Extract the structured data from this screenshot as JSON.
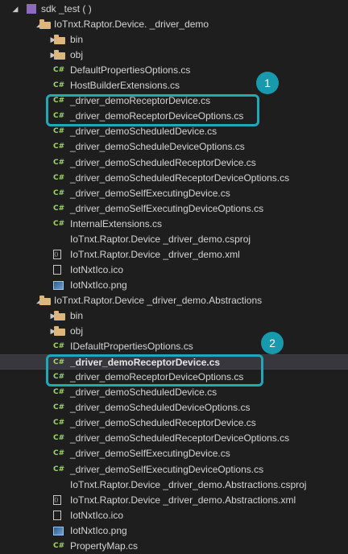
{
  "rows": [
    {
      "label": "sdk     _test (                                        )",
      "kind": "solution",
      "expanded": true
    },
    {
      "label": "IoTnxt.Raptor.Device.      _driver_demo",
      "kind": "folder",
      "expanded": true
    },
    {
      "label": "bin",
      "kind": "folder",
      "expanded": false
    },
    {
      "label": "obj",
      "kind": "folder",
      "expanded": false
    },
    {
      "label": "DefaultPropertiesOptions.cs",
      "kind": "cs"
    },
    {
      "label": "HostBuilderExtensions.cs",
      "kind": "cs"
    },
    {
      "label": "_driver_demoReceptorDevice.cs",
      "kind": "cs"
    },
    {
      "label": "_driver_demoReceptorDeviceOptions.cs",
      "kind": "cs"
    },
    {
      "label": "_driver_demoScheduledDevice.cs",
      "kind": "cs"
    },
    {
      "label": "_driver_demoScheduleDeviceOptions.cs",
      "kind": "cs"
    },
    {
      "label": "_driver_demoScheduledReceptorDevice.cs",
      "kind": "cs"
    },
    {
      "label": "_driver_demoScheduledReceptorDeviceOptions.cs",
      "kind": "cs"
    },
    {
      "label": "_driver_demoSelfExecutingDevice.cs",
      "kind": "cs"
    },
    {
      "label": "_driver_demoSelfExecutingDeviceOptions.cs",
      "kind": "cs"
    },
    {
      "label": "InternalExtensions.cs",
      "kind": "cs"
    },
    {
      "label": "IoTnxt.Raptor.Device       _driver_demo.csproj",
      "kind": "csproj"
    },
    {
      "label": "IoTnxt.Raptor.Device       _driver_demo.xml",
      "kind": "xml"
    },
    {
      "label": "IotNxtIco.ico",
      "kind": "ico"
    },
    {
      "label": "IotNxtIco.png",
      "kind": "png"
    },
    {
      "label": "IoTnxt.Raptor.Device       _driver_demo.Abstractions",
      "kind": "folder",
      "expanded": true
    },
    {
      "label": "bin",
      "kind": "folder",
      "expanded": false
    },
    {
      "label": "obj",
      "kind": "folder",
      "expanded": false
    },
    {
      "label": "IDefaultPropertiesOptions.cs",
      "kind": "cs"
    },
    {
      "label": "_driver_demoReceptorDevice.cs",
      "kind": "cs",
      "selected": true
    },
    {
      "label": "_driver_demoReceptorDeviceOptions.cs",
      "kind": "cs"
    },
    {
      "label": "_driver_demoScheduledDevice.cs",
      "kind": "cs"
    },
    {
      "label": "_driver_demoScheduledDeviceOptions.cs",
      "kind": "cs"
    },
    {
      "label": "_driver_demoScheduledReceptorDevice.cs",
      "kind": "cs"
    },
    {
      "label": "_driver_demoScheduledReceptorDeviceOptions.cs",
      "kind": "cs"
    },
    {
      "label": "_driver_demoSelfExecutingDevice.cs",
      "kind": "cs"
    },
    {
      "label": "_driver_demoSelfExecutingDeviceOptions.cs",
      "kind": "cs"
    },
    {
      "label": "IoTnxt.Raptor.Device       _driver_demo.Abstractions.csproj",
      "kind": "csproj"
    },
    {
      "label": "IoTnxt.Raptor.Device       _driver_demo.Abstractions.xml",
      "kind": "xml"
    },
    {
      "label": "IotNxtIco.ico",
      "kind": "ico"
    },
    {
      "label": "IotNxtIco.png",
      "kind": "png"
    },
    {
      "label": "PropertyMap.cs",
      "kind": "cs"
    }
  ],
  "callouts": [
    {
      "number": "1"
    },
    {
      "number": "2"
    }
  ],
  "colors": {
    "accent": "#1fa8b8",
    "cs_glyph": "#9bd66b",
    "folder": "#dcb67a",
    "background": "#1e1e1e"
  }
}
